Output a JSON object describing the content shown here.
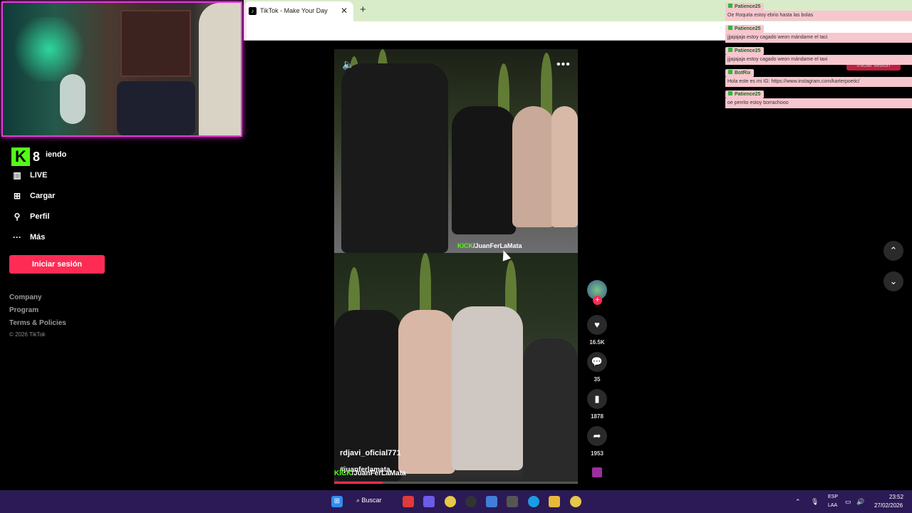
{
  "browser": {
    "tab_title": "TikTok - Make Your Day",
    "tab_close": "✕",
    "new_tab": "+"
  },
  "stream": {
    "viewer_count": "8",
    "following_fragment": "iendo"
  },
  "sidebar": {
    "items": [
      {
        "label": "LIVE",
        "icon": "live-icon"
      },
      {
        "label": "Cargar",
        "icon": "upload-icon"
      },
      {
        "label": "Perfil",
        "icon": "profile-icon"
      },
      {
        "label": "Más",
        "icon": "more-icon"
      }
    ],
    "login_button": "Iniciar sesión",
    "footer": [
      "Company",
      "Program",
      "Terms & Policies"
    ],
    "copyright": "© 2026 TikTok"
  },
  "video": {
    "author": "rdjavi_oficial771",
    "hashtag": "#juanferlamata",
    "watermark_brand": "KICK",
    "watermark_handle": "/JuanFerLaMata",
    "progress": 0.2
  },
  "actions": {
    "likes": "16.5K",
    "comments": "35",
    "saves": "1878",
    "shares": "1953"
  },
  "chat": [
    {
      "user": "Patience25",
      "message": "Oe Roquita estoy ebrio hasta las bolas"
    },
    {
      "user": "Patience25",
      "message": "jjjajajaja estoy cagado weon mándame el taci"
    },
    {
      "user": "Patience25",
      "message": "jjjajajaja estoy cagado weon mándame el taxi"
    },
    {
      "user": "BotRix",
      "message": "Hola este es mi IG: https://www.instagram.com/karterpoetic/"
    },
    {
      "user": "Patience25",
      "message": "oe perrito estoy borrachooo"
    }
  ],
  "overlay_login": "Iniciar sesión",
  "taskbar": {
    "search_label": "Buscar",
    "lang_1": "ESP",
    "lang_2": "LAA",
    "time": "23:52",
    "date": "27/02/2026"
  },
  "colors": {
    "accent": "#fe2c55",
    "kick_green": "#53fc18",
    "webcam_border": "#e13cd6",
    "taskbar": "#2b1a55",
    "chat_bg": "#f7c6cf"
  }
}
